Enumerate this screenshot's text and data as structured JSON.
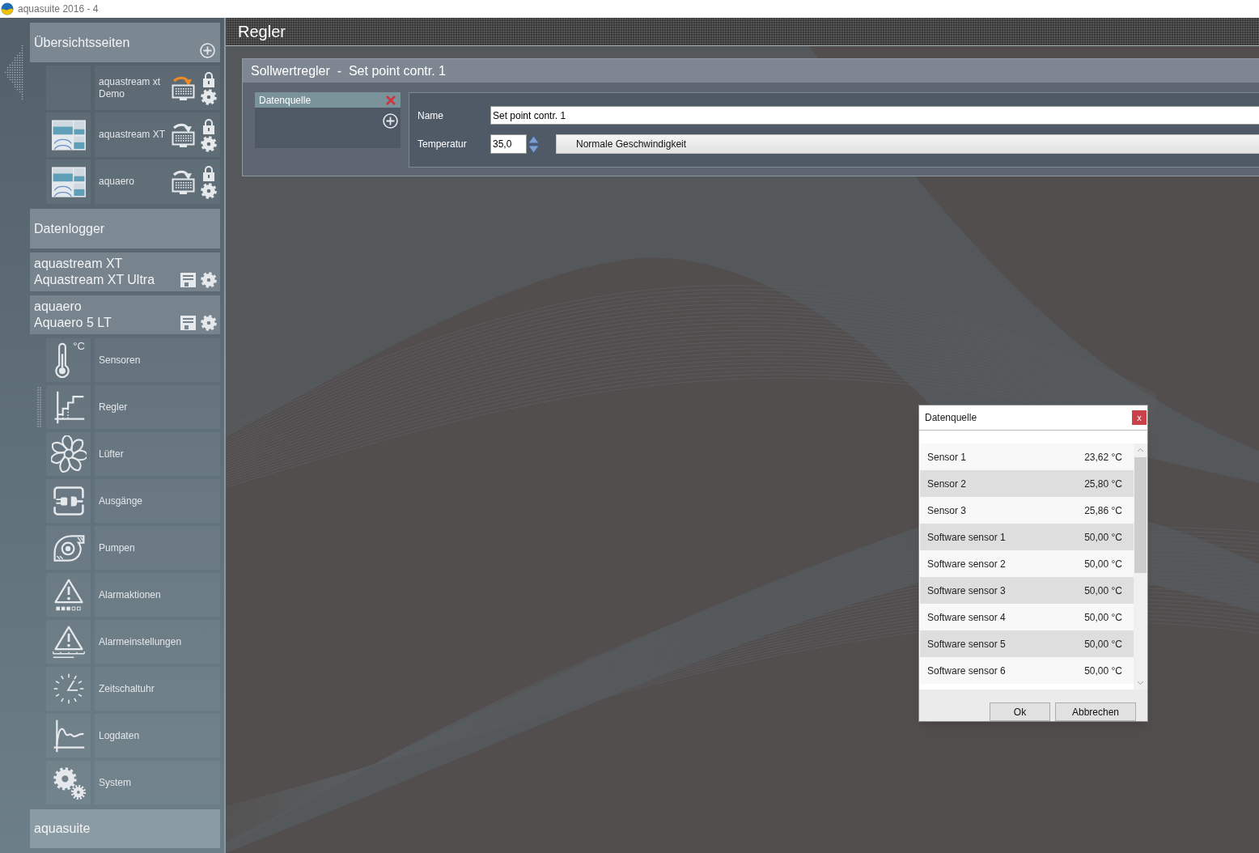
{
  "window": {
    "title": "aquasuite 2016 - 4"
  },
  "sidebar": {
    "overview": {
      "title": "Übersichtsseiten",
      "pages": [
        {
          "label": "aquastream xt Demo",
          "thumbnail": false,
          "active": true
        },
        {
          "label": "aquastream XT",
          "thumbnail": true,
          "active": false
        },
        {
          "label": "aquaero",
          "thumbnail": true,
          "active": false
        }
      ]
    },
    "datalogger": {
      "title": "Datenlogger"
    },
    "devices": [
      {
        "name": "aquastream XT",
        "model": "Aquastream XT Ultra"
      },
      {
        "name": "aquaero",
        "model": "Aquaero 5 LT",
        "items": [
          {
            "label": "Sensoren",
            "kind": "thermometer",
            "icon_text": "°C",
            "selected": false
          },
          {
            "label": "Regler",
            "kind": "staircase",
            "selected": true
          },
          {
            "label": "Lüfter",
            "kind": "fan",
            "selected": false
          },
          {
            "label": "Ausgänge",
            "kind": "plug",
            "selected": false
          },
          {
            "label": "Pumpen",
            "kind": "pump",
            "selected": false
          },
          {
            "label": "Alarmaktionen",
            "kind": "alarm",
            "selected": false
          },
          {
            "label": "Alarmeinstellungen",
            "kind": "alarmscale",
            "selected": false
          },
          {
            "label": "Zeitschaltuhr",
            "kind": "clock",
            "selected": false
          },
          {
            "label": "Logdaten",
            "kind": "chart",
            "selected": false
          },
          {
            "label": "System",
            "kind": "gears",
            "selected": false
          }
        ]
      }
    ],
    "footer": {
      "title": "aquasuite"
    }
  },
  "main": {
    "title": "Regler",
    "panel": {
      "title": "Sollwertregler  -  Set point contr. 1",
      "sources": [
        {
          "label": "Datenquelle"
        }
      ],
      "name_field": {
        "label": "Name",
        "value": "Set point contr. 1"
      },
      "temperature_field": {
        "label": "Temperatur",
        "value": "35,0"
      },
      "mode_button": {
        "label": "Normale Geschwindigkeit"
      }
    }
  },
  "dialog": {
    "title": "Datenquelle",
    "close": "x",
    "rows": [
      {
        "name": "Sensor 1",
        "value": "23,62 °C"
      },
      {
        "name": "Sensor 2",
        "value": "25,80 °C"
      },
      {
        "name": "Sensor 3",
        "value": "25,86 °C"
      },
      {
        "name": "Software sensor 1",
        "value": "50,00 °C"
      },
      {
        "name": "Software sensor 2",
        "value": "50,00 °C"
      },
      {
        "name": "Software sensor 3",
        "value": "50,00 °C"
      },
      {
        "name": "Software sensor 4",
        "value": "50,00 °C"
      },
      {
        "name": "Software sensor 5",
        "value": "50,00 °C"
      },
      {
        "name": "Software sensor 6",
        "value": "50,00 °C"
      }
    ],
    "buttons": [
      {
        "label": "Ok"
      },
      {
        "label": "Abbrechen"
      }
    ]
  }
}
